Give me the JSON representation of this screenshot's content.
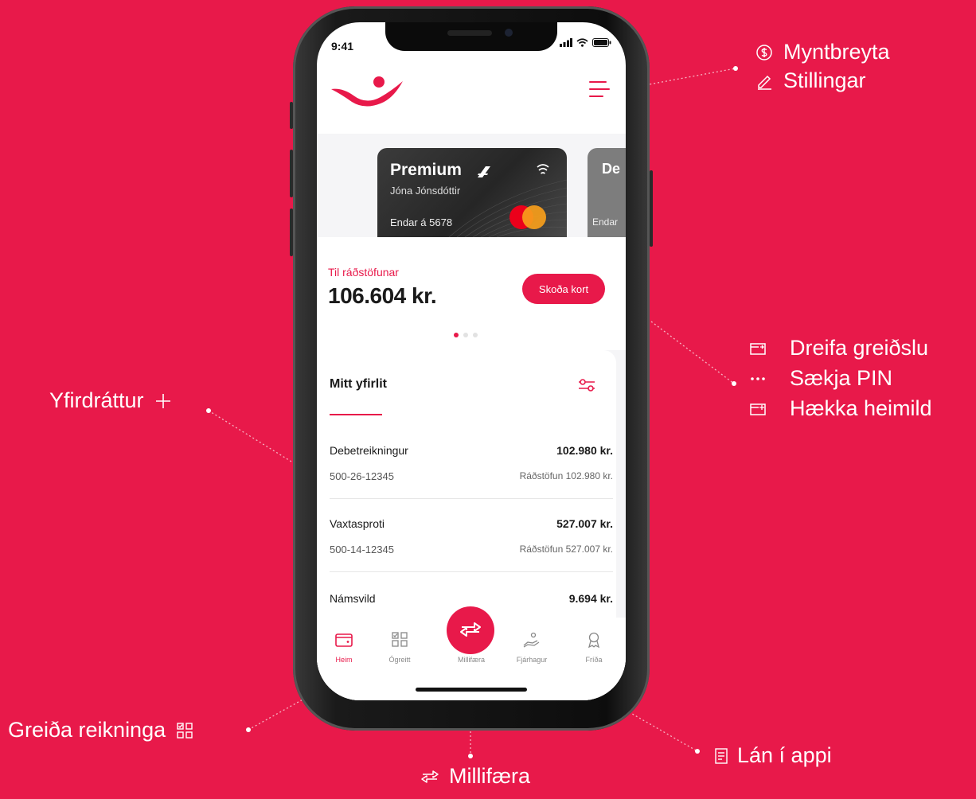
{
  "phone": {
    "status": {
      "time": "9:41"
    },
    "cards": [
      {
        "name": "Premium",
        "holder": "Jóna Jónsdóttir",
        "ending": "Endar á 5678"
      },
      {
        "name": "De",
        "ending": "Endar"
      }
    ],
    "balance": {
      "label": "Til ráðstöfunar",
      "amount": "106.604 kr.",
      "button": "Skoða kort"
    },
    "carousel": {
      "count": 3,
      "active": 1
    },
    "overview": {
      "title": "Mitt yfirlit",
      "accounts": [
        {
          "name": "Debetreikningur",
          "amount": "102.980 kr.",
          "number": "500-26-12345",
          "disposable": "Ráðstöfun 102.980 kr."
        },
        {
          "name": "Vaxtasproti",
          "amount": "527.007 kr.",
          "number": "500-14-12345",
          "disposable": "Ráðstöfun 527.007 kr."
        },
        {
          "name": "Námsvild",
          "amount": "9.694 kr."
        }
      ]
    },
    "nav": [
      {
        "label": "Heim",
        "icon": "wallet-icon",
        "active": true
      },
      {
        "label": "Ógreitt",
        "icon": "bills-grid-icon"
      },
      {
        "label": "Millifæra",
        "icon": "transfer-arrows-icon"
      },
      {
        "label": "Fjárhagur",
        "icon": "hand-coin-icon"
      },
      {
        "label": "Fríða",
        "icon": "badge-icon"
      }
    ]
  },
  "callouts": {
    "menu": [
      {
        "label": "Myntbreyta",
        "icon": "currency-icon"
      },
      {
        "label": "Stillingar",
        "icon": "pencil-icon"
      }
    ],
    "card_actions": [
      {
        "label": "Dreifa greiðslu",
        "icon": "split-payment-icon"
      },
      {
        "label": "Sækja PIN",
        "icon": "dots-icon"
      },
      {
        "label": "Hækka heimild",
        "icon": "increase-limit-icon"
      }
    ],
    "overdraft": {
      "label": "Yfirdráttur",
      "icon": "plus-icon"
    },
    "pay_bills": {
      "label": "Greiða reikninga",
      "icon": "bills-grid-icon"
    },
    "transfer": {
      "label": "Millifæra",
      "icon": "transfer-arrows-icon"
    },
    "loan": {
      "label": "Lán í appi",
      "icon": "document-icon"
    }
  },
  "colors": {
    "brand": "#e8194a",
    "text": "#1a1a1a",
    "muted": "#666666"
  }
}
